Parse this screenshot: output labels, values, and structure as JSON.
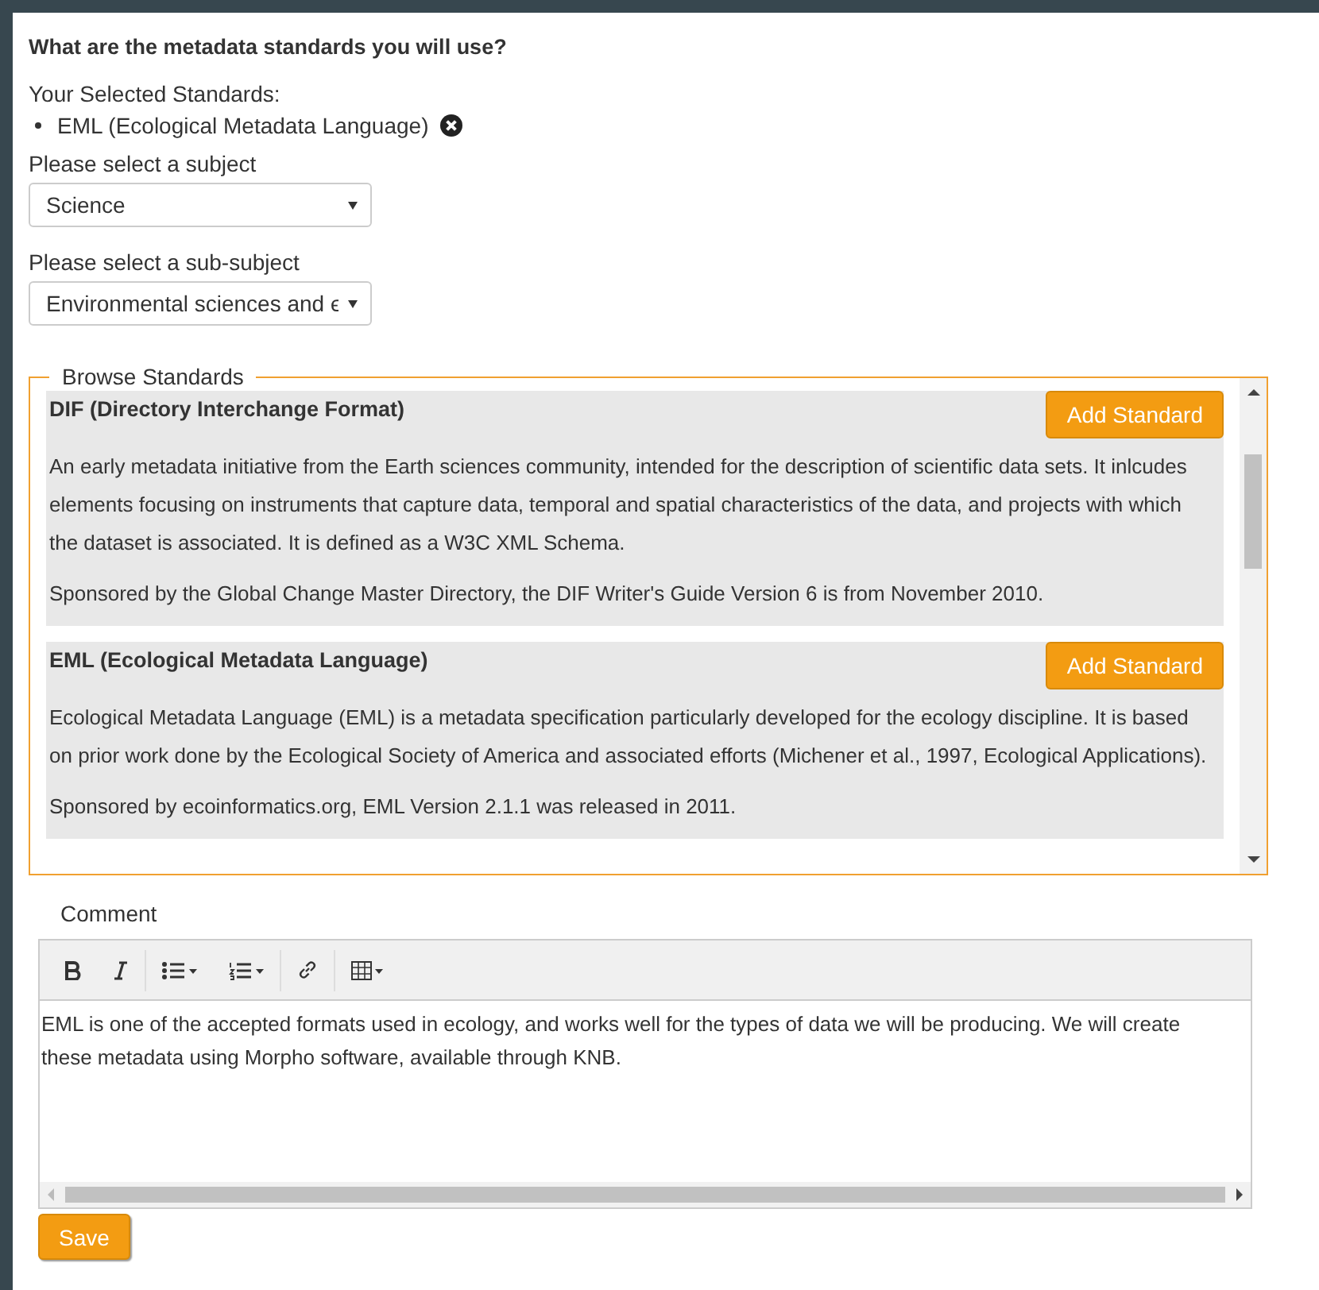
{
  "question": "What are the metadata standards you will use?",
  "selected_label": "Your Selected Standards:",
  "selected_standards": [
    {
      "name": "EML (Ecological Metadata Language)"
    }
  ],
  "subject": {
    "label": "Please select a subject",
    "value": "Science"
  },
  "sub_subject": {
    "label": "Please select a sub-subject",
    "value": "Environmental sciences and ϵ"
  },
  "browse": {
    "legend": "Browse Standards",
    "standards": [
      {
        "title": "DIF (Directory Interchange Format)",
        "button": "Add Standard",
        "description": "An early metadata initiative from the Earth sciences community, intended for the description of scientific data sets. It inlcudes elements focusing on instruments that capture data, temporal and spatial characteristics of the data, and projects with which the dataset is associated. It is defined as a W3C XML Schema.",
        "sponsor": "Sponsored by the Global Change Master Directory, the DIF Writer's Guide Version 6 is from November 2010."
      },
      {
        "title": "EML (Ecological Metadata Language)",
        "button": "Add Standard",
        "description": "Ecological Metadata Language (EML) is a metadata specification particularly developed for the ecology discipline. It is based on prior work done by the Ecological Society of America and associated efforts (Michener et al., 1997, Ecological Applications).",
        "sponsor": "Sponsored by ecoinformatics.org, EML Version 2.1.1 was released in 2011."
      }
    ]
  },
  "comment": {
    "label": "Comment",
    "toolbar": [
      {
        "kind": "bold"
      },
      {
        "kind": "italic"
      },
      {
        "kind": "bullets"
      },
      {
        "kind": "numbers"
      },
      {
        "kind": "link"
      },
      {
        "kind": "table"
      }
    ],
    "text": "EML is one of the accepted formats used in ecology, and works well for the types of data we will be producing. We will create these metadata using Morpho software, available through KNB."
  },
  "save_button": "Save"
}
